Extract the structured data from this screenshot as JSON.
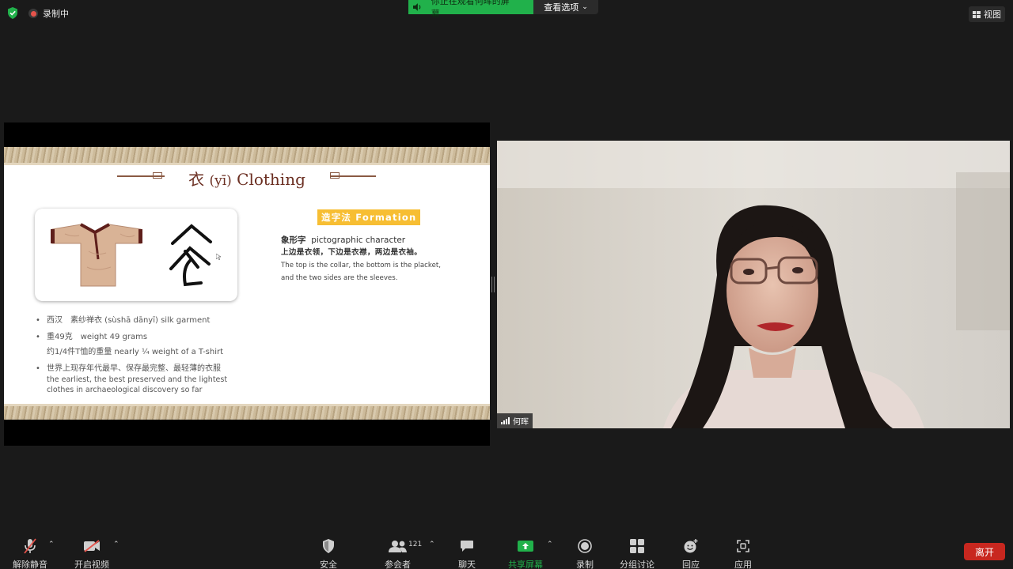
{
  "topbar": {
    "recording_label": "录制中",
    "banner_text": "你正在观看何晖的屏幕",
    "view_options": "查看选项",
    "view_button": "视图",
    "colors": {
      "banner_green": "#21b14b",
      "shield_green": "#21b14b",
      "recording_red": "#e5534b"
    }
  },
  "slide": {
    "title_cn": "衣",
    "title_pinyin": "(yī)",
    "title_en": "Clothing",
    "formation_label": "造字法 Formation",
    "desc": {
      "type_cn": "象形字",
      "type_en": "pictographic character",
      "explanation_cn": "上边是衣领，下边是衣襟，两边是衣袖。",
      "explanation_en_1": "The top is the collar, the bottom is the placket,",
      "explanation_en_2": "and the two sides are the sleeves."
    },
    "bullets": {
      "b1": "西汉　素纱禅衣 (sùshā dānyī) silk garment",
      "b2": "重49克　weight 49 grams",
      "b2_sub": "约1/4件T恤的重量 nearly ¼ weight of a T-shirt",
      "b3_cn": "世界上现存年代最早、保存最完整、最轻薄的衣服",
      "b3_en_1": "the earliest, the best preserved and the lightest",
      "b3_en_2": "clothes in archaeological discovery so far"
    },
    "colors": {
      "title": "#6b2f22",
      "formation_bg": "#f7be33"
    }
  },
  "video": {
    "participant_name": "何晖"
  },
  "toolbar": {
    "unmute": "解除静音",
    "start_video": "开启视频",
    "security": "安全",
    "participants": "参会者",
    "participant_count": "121",
    "chat": "聊天",
    "share_screen": "共享屏幕",
    "record": "录制",
    "breakout": "分组讨论",
    "reactions": "回应",
    "apps": "应用",
    "leave": "离开",
    "colors": {
      "share_green": "#21b14b",
      "leave_red": "#c8271f",
      "muted_red": "#e5534b"
    }
  }
}
